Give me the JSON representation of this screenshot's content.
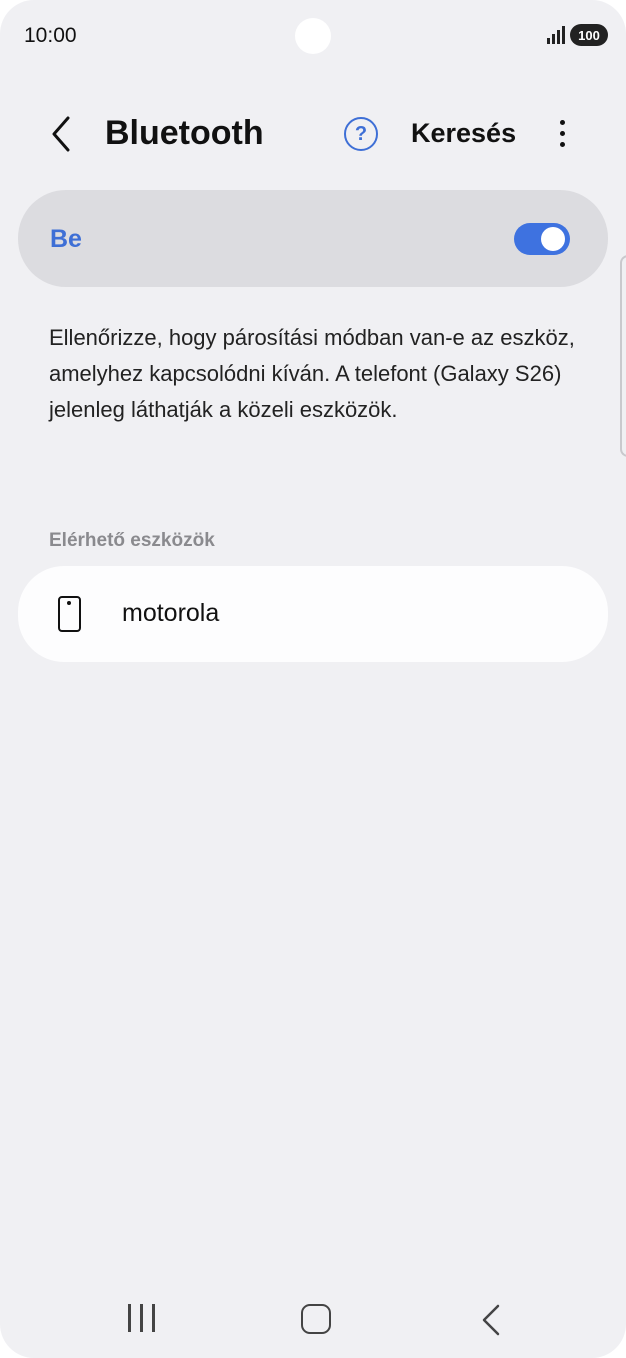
{
  "status_bar": {
    "time": "10:00",
    "battery": "100",
    "signal_icon": "signal-bars-icon"
  },
  "header": {
    "title": "Bluetooth",
    "back_icon": "chevron-left-icon",
    "help_icon": "question-circle-icon",
    "help_glyph": "?",
    "search_label": "Keresés",
    "more_icon": "vertical-dots-icon"
  },
  "bluetooth_toggle": {
    "label": "Be",
    "state": true,
    "accent_color": "#3e72e0"
  },
  "description": "Ellenőrizze, hogy párosítási módban van-e az eszköz, amelyhez kapcsolódni kíván. A telefont (Galaxy S26) jelenleg láthatják a közeli eszközök.",
  "available_devices": {
    "header": "Elérhető eszközök",
    "items": [
      {
        "name": "motorola",
        "icon": "smartphone-icon"
      }
    ]
  },
  "nav_bar": {
    "recents_icon": "recent-apps-icon",
    "home_icon": "home-icon",
    "back_icon": "back-chevron-icon"
  }
}
